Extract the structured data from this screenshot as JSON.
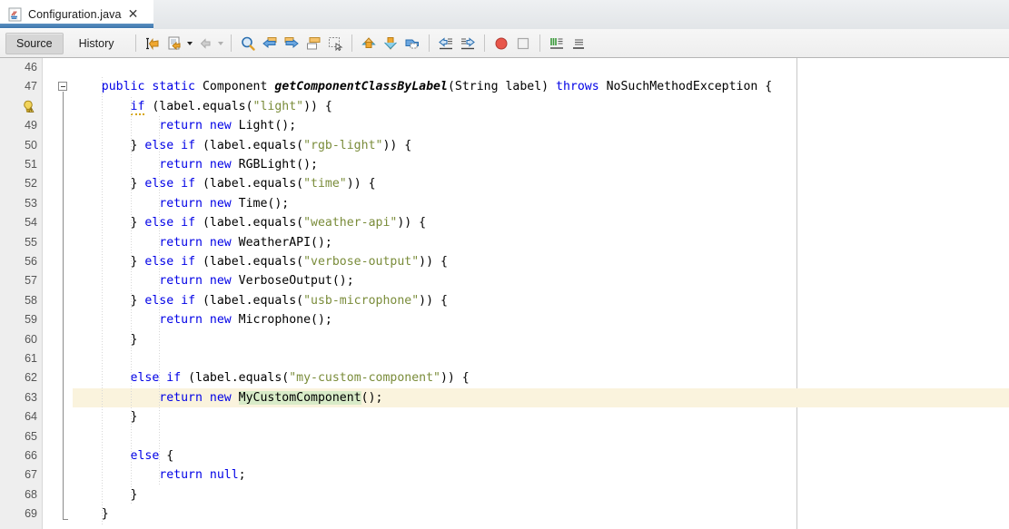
{
  "window": {
    "tab": {
      "title": "Configuration.java",
      "icon": "java-file-icon",
      "close_label": "✕",
      "accent_color": "#4a83b8"
    }
  },
  "toolbar": {
    "mode_tabs": [
      {
        "label": "Source",
        "selected": true
      },
      {
        "label": "History",
        "selected": false
      }
    ],
    "buttons": [
      {
        "name": "last-edit-position-icon"
      },
      {
        "name": "toggle-rectangular-selection-icon"
      },
      {
        "name": "shift-line-right-icon"
      },
      {
        "name": "find-selection-icon"
      },
      {
        "name": "previous-bookmark-icon"
      },
      {
        "name": "next-bookmark-icon"
      },
      {
        "name": "toggle-bookmark-icon"
      },
      {
        "name": "toggle-rect-select-icon"
      },
      {
        "name": "shift-line-left-arrow-icon"
      },
      {
        "name": "shift-line-right-arrow-icon"
      },
      {
        "name": "comment-icon"
      },
      {
        "name": "shift-left-icon"
      },
      {
        "name": "shift-right-icon"
      },
      {
        "name": "toggle-breakpoint-icon"
      },
      {
        "name": "stop-icon"
      },
      {
        "name": "run-to-cursor-icon"
      },
      {
        "name": "inspect-icon"
      }
    ]
  },
  "editor": {
    "current_line": 63,
    "margin_column_x": 877,
    "current_line_highlight": "#faf3dd",
    "occurrence_highlight": "#d8ebc8",
    "gutter_bg": "#eeeeee",
    "warning_line": 48,
    "warning_icon": "lightbulb-warning-icon",
    "lines": [
      {
        "no": "46",
        "tokens": []
      },
      {
        "no": "47",
        "tokens": [
          {
            "t": "    ",
            "c": "plain"
          },
          {
            "t": "public",
            "c": "kw"
          },
          {
            "t": " ",
            "c": "plain"
          },
          {
            "t": "static",
            "c": "kw"
          },
          {
            "t": " ",
            "c": "plain"
          },
          {
            "t": "Component",
            "c": "plain"
          },
          {
            "t": " ",
            "c": "plain"
          },
          {
            "t": "getComponentClassByLabel",
            "c": "meth"
          },
          {
            "t": "(String label) ",
            "c": "plain"
          },
          {
            "t": "throws",
            "c": "kw"
          },
          {
            "t": " NoSuchMethodException {",
            "c": "plain"
          }
        ]
      },
      {
        "no": "48",
        "tokens": [
          {
            "t": "        ",
            "c": "plain"
          },
          {
            "t": "if",
            "c": "kw-warn"
          },
          {
            "t": " (label.equals(",
            "c": "plain"
          },
          {
            "t": "\"light\"",
            "c": "str"
          },
          {
            "t": ")) {",
            "c": "plain"
          }
        ]
      },
      {
        "no": "49",
        "tokens": [
          {
            "t": "            ",
            "c": "plain"
          },
          {
            "t": "return",
            "c": "kw"
          },
          {
            "t": " ",
            "c": "plain"
          },
          {
            "t": "new",
            "c": "kw"
          },
          {
            "t": " Light();",
            "c": "plain"
          }
        ]
      },
      {
        "no": "50",
        "tokens": [
          {
            "t": "        } ",
            "c": "plain"
          },
          {
            "t": "else",
            "c": "kw"
          },
          {
            "t": " ",
            "c": "plain"
          },
          {
            "t": "if",
            "c": "kw"
          },
          {
            "t": " (label.equals(",
            "c": "plain"
          },
          {
            "t": "\"rgb-light\"",
            "c": "str"
          },
          {
            "t": ")) {",
            "c": "plain"
          }
        ]
      },
      {
        "no": "51",
        "tokens": [
          {
            "t": "            ",
            "c": "plain"
          },
          {
            "t": "return",
            "c": "kw"
          },
          {
            "t": " ",
            "c": "plain"
          },
          {
            "t": "new",
            "c": "kw"
          },
          {
            "t": " RGBLight();",
            "c": "plain"
          }
        ]
      },
      {
        "no": "52",
        "tokens": [
          {
            "t": "        } ",
            "c": "plain"
          },
          {
            "t": "else",
            "c": "kw"
          },
          {
            "t": " ",
            "c": "plain"
          },
          {
            "t": "if",
            "c": "kw"
          },
          {
            "t": " (label.equals(",
            "c": "plain"
          },
          {
            "t": "\"time\"",
            "c": "str"
          },
          {
            "t": ")) {",
            "c": "plain"
          }
        ]
      },
      {
        "no": "53",
        "tokens": [
          {
            "t": "            ",
            "c": "plain"
          },
          {
            "t": "return",
            "c": "kw"
          },
          {
            "t": " ",
            "c": "plain"
          },
          {
            "t": "new",
            "c": "kw"
          },
          {
            "t": " Time();",
            "c": "plain"
          }
        ]
      },
      {
        "no": "54",
        "tokens": [
          {
            "t": "        } ",
            "c": "plain"
          },
          {
            "t": "else",
            "c": "kw"
          },
          {
            "t": " ",
            "c": "plain"
          },
          {
            "t": "if",
            "c": "kw"
          },
          {
            "t": " (label.equals(",
            "c": "plain"
          },
          {
            "t": "\"weather-api\"",
            "c": "str"
          },
          {
            "t": ")) {",
            "c": "plain"
          }
        ]
      },
      {
        "no": "55",
        "tokens": [
          {
            "t": "            ",
            "c": "plain"
          },
          {
            "t": "return",
            "c": "kw"
          },
          {
            "t": " ",
            "c": "plain"
          },
          {
            "t": "new",
            "c": "kw"
          },
          {
            "t": " WeatherAPI();",
            "c": "plain"
          }
        ]
      },
      {
        "no": "56",
        "tokens": [
          {
            "t": "        } ",
            "c": "plain"
          },
          {
            "t": "else",
            "c": "kw"
          },
          {
            "t": " ",
            "c": "plain"
          },
          {
            "t": "if",
            "c": "kw"
          },
          {
            "t": " (label.equals(",
            "c": "plain"
          },
          {
            "t": "\"verbose-output\"",
            "c": "str"
          },
          {
            "t": ")) {",
            "c": "plain"
          }
        ]
      },
      {
        "no": "57",
        "tokens": [
          {
            "t": "            ",
            "c": "plain"
          },
          {
            "t": "return",
            "c": "kw"
          },
          {
            "t": " ",
            "c": "plain"
          },
          {
            "t": "new",
            "c": "kw"
          },
          {
            "t": " VerboseOutput();",
            "c": "plain"
          }
        ]
      },
      {
        "no": "58",
        "tokens": [
          {
            "t": "        } ",
            "c": "plain"
          },
          {
            "t": "else",
            "c": "kw"
          },
          {
            "t": " ",
            "c": "plain"
          },
          {
            "t": "if",
            "c": "kw"
          },
          {
            "t": " (label.equals(",
            "c": "plain"
          },
          {
            "t": "\"usb-microphone\"",
            "c": "str"
          },
          {
            "t": ")) {",
            "c": "plain"
          }
        ]
      },
      {
        "no": "59",
        "tokens": [
          {
            "t": "            ",
            "c": "plain"
          },
          {
            "t": "return",
            "c": "kw"
          },
          {
            "t": " ",
            "c": "plain"
          },
          {
            "t": "new",
            "c": "kw"
          },
          {
            "t": " Microphone();",
            "c": "plain"
          }
        ]
      },
      {
        "no": "60",
        "tokens": [
          {
            "t": "        }",
            "c": "plain"
          }
        ]
      },
      {
        "no": "61",
        "tokens": []
      },
      {
        "no": "62",
        "tokens": [
          {
            "t": "        ",
            "c": "plain"
          },
          {
            "t": "else",
            "c": "kw"
          },
          {
            "t": " ",
            "c": "plain"
          },
          {
            "t": "if",
            "c": "kw"
          },
          {
            "t": " (label.equals(",
            "c": "plain"
          },
          {
            "t": "\"my-custom-component\"",
            "c": "str"
          },
          {
            "t": ")) {",
            "c": "plain"
          }
        ]
      },
      {
        "no": "63",
        "tokens": [
          {
            "t": "            ",
            "c": "plain"
          },
          {
            "t": "return",
            "c": "kw"
          },
          {
            "t": " ",
            "c": "plain"
          },
          {
            "t": "new",
            "c": "kw"
          },
          {
            "t": " ",
            "c": "plain"
          },
          {
            "t": "MyCustomComponent",
            "c": "occ"
          },
          {
            "t": "();",
            "c": "plain"
          }
        ]
      },
      {
        "no": "64",
        "tokens": [
          {
            "t": "        }",
            "c": "plain"
          }
        ]
      },
      {
        "no": "65",
        "tokens": []
      },
      {
        "no": "66",
        "tokens": [
          {
            "t": "        ",
            "c": "plain"
          },
          {
            "t": "else",
            "c": "kw"
          },
          {
            "t": " {",
            "c": "plain"
          }
        ]
      },
      {
        "no": "67",
        "tokens": [
          {
            "t": "            ",
            "c": "plain"
          },
          {
            "t": "return",
            "c": "kw"
          },
          {
            "t": " ",
            "c": "plain"
          },
          {
            "t": "null",
            "c": "kw"
          },
          {
            "t": ";",
            "c": "plain"
          }
        ]
      },
      {
        "no": "68",
        "tokens": [
          {
            "t": "        }",
            "c": "plain"
          }
        ]
      },
      {
        "no": "69",
        "tokens": [
          {
            "t": "    }",
            "c": "plain"
          }
        ]
      }
    ]
  }
}
